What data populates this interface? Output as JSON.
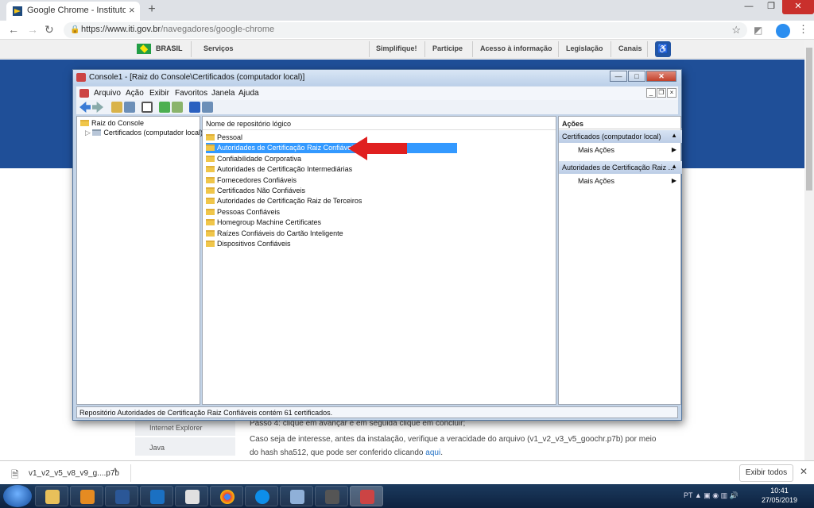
{
  "browser": {
    "tab_title": "Google Chrome - Instituto Nacio",
    "tab_close": "×",
    "new_tab": "+",
    "url_host": "https://www.iti.gov.br",
    "url_path": "/navegadores/google-chrome",
    "window_controls": [
      "—",
      "❐",
      "✕"
    ]
  },
  "gov": {
    "brasil": "BRASIL",
    "servicos": "Serviços",
    "links": [
      "Simplifique!",
      "Participe",
      "Acesso à informação",
      "Legislação",
      "Canais"
    ]
  },
  "page": {
    "left_menu": [
      "Internet Explorer",
      "Java"
    ],
    "behind_text": "Passo 4: clique em avançar e em seguida clique em concluir;",
    "para_line1": "Caso seja de interesse, antes da instalação, verifique a veracidade do arquivo (v1_v2_v3_v5_goochr.p7b) por meio",
    "para_line2_prefix": "do hash sha512, que pode ser conferido clicando ",
    "para_link": "aqui",
    "para_suffix": "."
  },
  "console": {
    "title": "Console1 - [Raiz do Console\\Certificados (computador local)]",
    "menu": [
      "Arquivo",
      "Ação",
      "Exibir",
      "Favoritos",
      "Janela",
      "Ajuda"
    ],
    "tree": {
      "root": "Raiz do Console",
      "child": "Certificados (computador local)"
    },
    "column_header": "Nome de repositório lógico",
    "stores": [
      "Pessoal",
      "Autoridades de Certificação Raiz Confiáveis",
      "Confiabilidade Corporativa",
      "Autoridades de Certificação Intermediárias",
      "Fornecedores Confiáveis",
      "Certificados Não Confiáveis",
      "Autoridades de Certificação Raiz de Terceiros",
      "Pessoas Confiáveis",
      "Homegroup Machine Certificates",
      "Raízes Confiáveis do Cartão Inteligente",
      "Dispositivos Confiáveis"
    ],
    "selected_index": 1,
    "actions": {
      "header": "Ações",
      "section1": "Certificados (computador local)",
      "section1_item": "Mais Ações",
      "section2": "Autoridades de Certificação Raiz ...",
      "section2_item": "Mais Ações"
    },
    "status": "Repositório Autoridades de Certificação Raiz Confiáveis contém 61 certificados."
  },
  "downloads": {
    "file": "v1_v2_v5_v8_v9_g....p7b",
    "show_all": "Exibir todos"
  },
  "taskbar": {
    "time": "10:41",
    "date": "27/05/2019"
  },
  "colors": {
    "banner_blue": "#1f4f98",
    "selection": "#3399ff",
    "arrow_red": "#e02020"
  }
}
